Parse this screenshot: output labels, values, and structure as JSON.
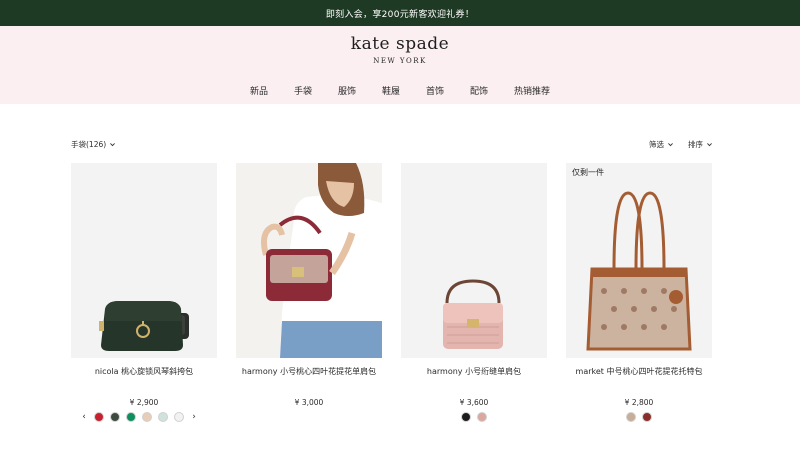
{
  "promo_text": "即刻入会，享200元新客欢迎礼券！",
  "brand": {
    "name": "kate spade",
    "sub": "NEW YORK"
  },
  "nav": [
    "新品",
    "手袋",
    "服饰",
    "鞋履",
    "首饰",
    "配饰",
    "热销推荐"
  ],
  "toolbar": {
    "category": "手袋(126)",
    "filter": "筛选",
    "sort": "排序"
  },
  "colors": {
    "promo_bg": "#1f3a24",
    "header_bg": "#fbeff2"
  },
  "products": [
    {
      "name": "nicola 桃心旋锁风琴斜挎包",
      "price": "¥ 2,900",
      "badge": "",
      "swatches": [
        "#c8202f",
        "#3d4b3f",
        "#0f8f5d",
        "#e8cdb8",
        "#cfe3dc",
        "#f2f2f2"
      ]
    },
    {
      "name": "harmony 小号桃心四叶花提花单肩包",
      "price": "¥ 3,000",
      "badge": "",
      "swatches": []
    },
    {
      "name": "harmony 小号绗缝单肩包",
      "price": "¥ 3,600",
      "badge": "",
      "swatches": [
        "#1c1c1c",
        "#dba8a0"
      ]
    },
    {
      "name": "market 中号桃心四叶花提花托特包",
      "price": "¥ 2,800",
      "badge": "仅剩一件",
      "swatches": [
        "#c9ad96",
        "#8b2e2a"
      ]
    }
  ]
}
